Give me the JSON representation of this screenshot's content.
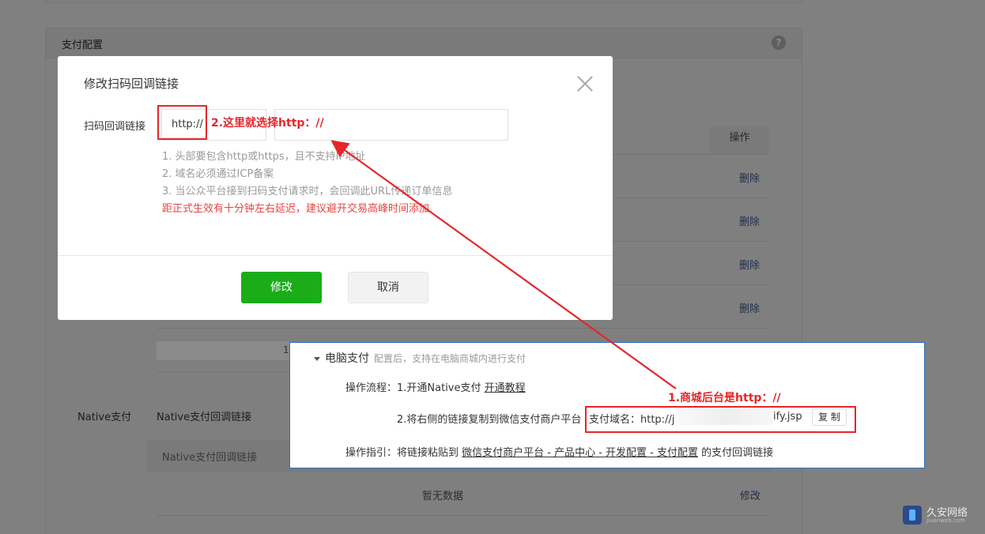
{
  "background": {
    "panel_title": "支付配置",
    "help_icon": "?",
    "op_header": "操作",
    "delete_labels": [
      "删除",
      "删除",
      "删除",
      "删除"
    ],
    "blurred_prefix": "1.",
    "native_label": "Native支付",
    "native_title": "Native支付回调链接",
    "native_table_header": "Native支付回调链接",
    "empty_text": "暂无数据",
    "modify_link": "修改"
  },
  "watermark": {
    "name": "久安网络",
    "domain": "Jiuanweb.com"
  },
  "dialog": {
    "title": "修改扫码回调链接",
    "field_label": "扫码回调链接",
    "protocol_value": "http://",
    "url_value": "",
    "tips": [
      "1. 头部要包含http或https，且不支持IP地址",
      "2. 域名必须通过ICP备案",
      "3. 当公众平台接到扫码支付请求时，会回调此URL传递订单信息"
    ],
    "warning": "距正式生效有十分钟左右延迟，建议避开交易高峰时间添加",
    "confirm_label": "修改",
    "cancel_label": "取消"
  },
  "annotations": {
    "step2": "2.这里就选择http：//",
    "step1": "1.商城后台是http：//",
    "color": "#e5262a"
  },
  "pc_payment": {
    "title": "电脑支付",
    "subtitle": "配置后，支持在电脑商城内进行支付",
    "flow_prefix": "操作流程：1.开通Native支付 ",
    "flow_link": "开通教程",
    "step2": "2.将右侧的链接复制到微信支付商户平台",
    "domain_prefix": "支付域名：http://j",
    "domain_suffix": "ify.jsp",
    "copy_label": "复 制",
    "guide_prefix": "操作指引：将链接粘贴到 ",
    "guide_link": "微信支付商户平台 - 产品中心 - 开发配置 - 支付配置",
    "guide_suffix": " 的支付回调链接"
  },
  "colors": {
    "primary_green": "#1aad19",
    "warning_red": "#e64340",
    "link_blue": "#576b95"
  }
}
